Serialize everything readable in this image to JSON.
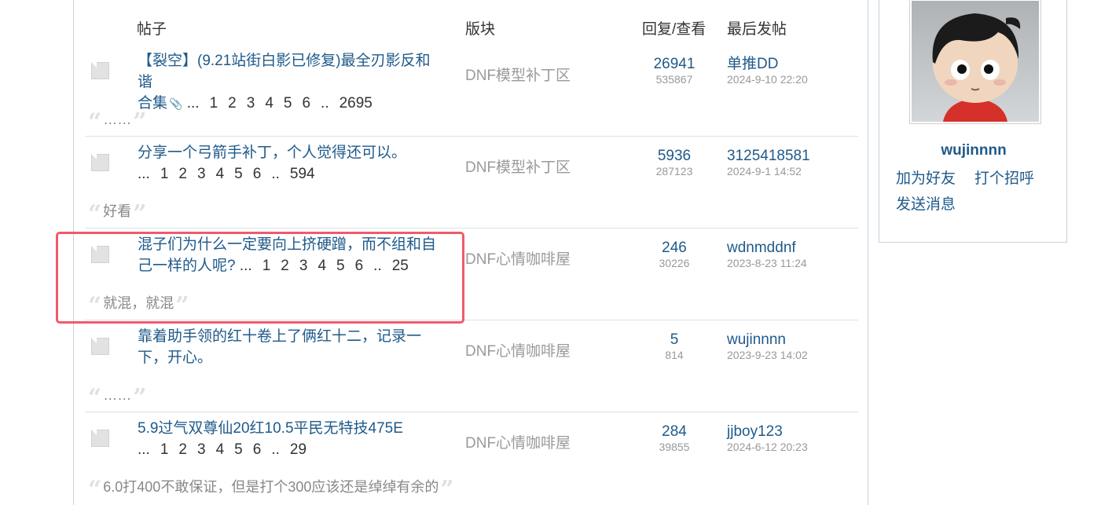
{
  "header": {
    "topic": "帖子",
    "forum": "版块",
    "stats": "回复/查看",
    "last_post": "最后发帖"
  },
  "threads": [
    {
      "title_line1": "【裂空】(9.21站街白影已修复)最全刃影反和谐",
      "title_line2": "合集",
      "has_attachment": true,
      "attachment_icon": "paperclip-icon",
      "pages": [
        "...",
        "1",
        "2",
        "3",
        "4",
        "5",
        "6",
        "..",
        "2695"
      ],
      "forum": "DNF模型补丁区",
      "replies": "26941",
      "views": "535867",
      "last_author": "单推DD",
      "last_time": "2024-9-10 22:20",
      "quote": "……"
    },
    {
      "title_line1": "分享一个弓箭手补丁，个人觉得还可以。",
      "title_line2": "",
      "has_attachment": false,
      "pages": [
        "...",
        "1",
        "2",
        "3",
        "4",
        "5",
        "6",
        "..",
        "594"
      ],
      "forum": "DNF模型补丁区",
      "replies": "5936",
      "views": "287123",
      "last_author": "3125418581",
      "last_time": "2024-9-1 14:52",
      "quote": "好看"
    },
    {
      "title_line1": "混子们为什么一定要向上挤硬蹭，而不组和自",
      "title_line2": "己一样的人呢?",
      "has_attachment": false,
      "pages": [
        "...",
        "1",
        "2",
        "3",
        "4",
        "5",
        "6",
        "..",
        "25"
      ],
      "forum": "DNF心情咖啡屋",
      "replies": "246",
      "views": "30226",
      "last_author": "wdnmddnf",
      "last_time": "2023-8-23 11:24",
      "quote": "就混，就混"
    },
    {
      "title_line1": "靠着助手领的红十卷上了俩红十二，记录一",
      "title_line2": "下，开心。",
      "has_attachment": false,
      "pages": [],
      "forum": "DNF心情咖啡屋",
      "replies": "5",
      "views": "814",
      "last_author": "wujinnnn",
      "last_time": "2023-9-23 14:02",
      "quote": "……"
    },
    {
      "title_line1": "5.9过气双尊仙20红10.5平民无特技475E",
      "title_line2": "",
      "has_attachment": false,
      "pages": [
        "...",
        "1",
        "2",
        "3",
        "4",
        "5",
        "6",
        "..",
        "29"
      ],
      "forum": "DNF心情咖啡屋",
      "replies": "284",
      "views": "39855",
      "last_author": "jjboy123",
      "last_time": "2024-6-12 20:23",
      "quote": "6.0打400不敢保证，但是打个300应该还是绰绰有余的"
    }
  ],
  "quote_marks": {
    "open": "“",
    "close": "”"
  },
  "profile": {
    "username": "wujinnnn",
    "add_friend": "加为好友",
    "say_hi": "打个招呼",
    "send_message": "发送消息",
    "avatar_icon": "cartoon-avatar-icon"
  },
  "colors": {
    "link": "#1f5a8a",
    "muted": "#9a9a9a",
    "highlight": "#ef5b6b",
    "border": "#c5d3de"
  }
}
